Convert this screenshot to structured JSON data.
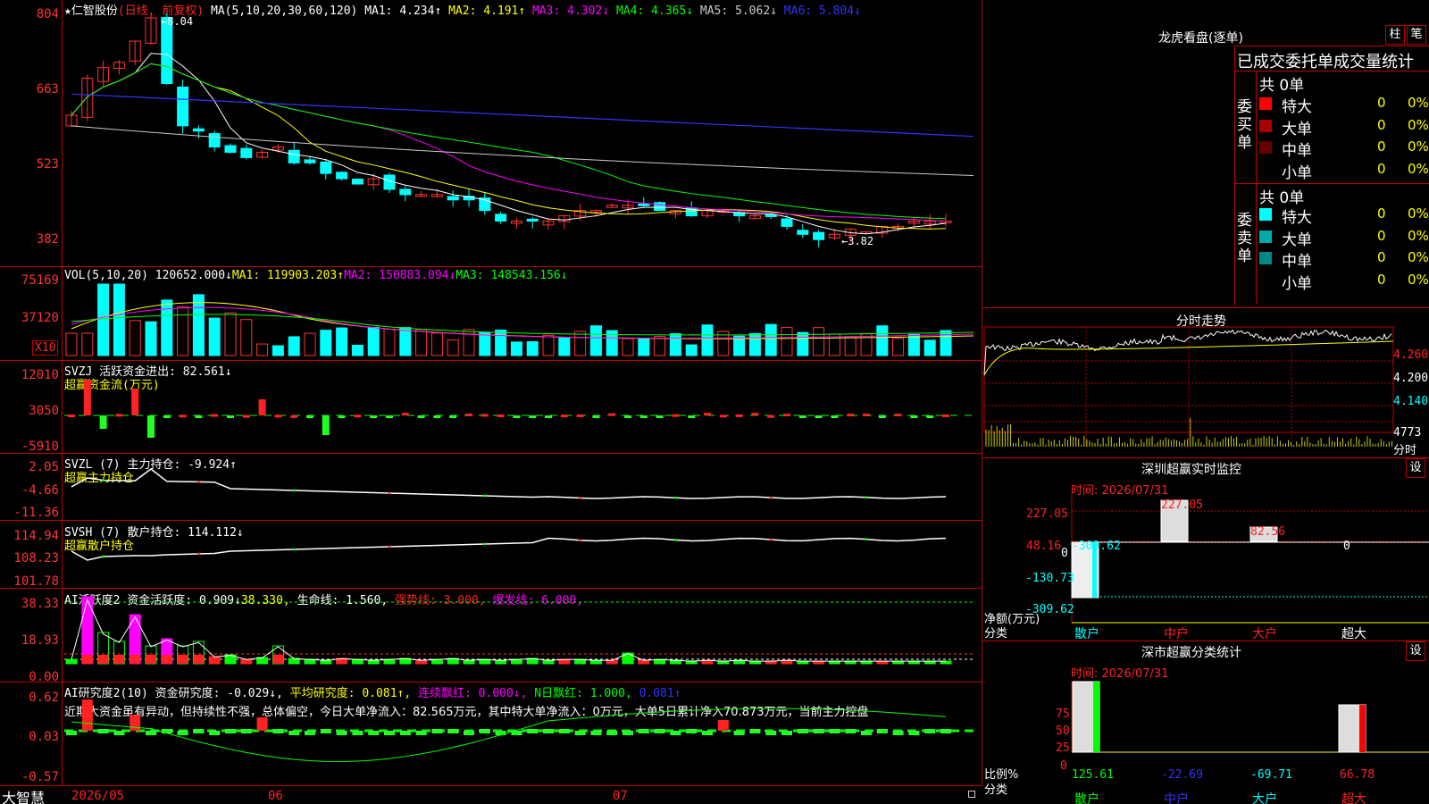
{
  "stock": {
    "name": "仁智股份",
    "mode": "(日线, 前复权)",
    "star": "★"
  },
  "ma_header": {
    "label": "MA(5,10,20,30,60,120)",
    "items": [
      {
        "name": "MA1",
        "text": "MA1: 4.234↑",
        "color": "#ffffff"
      },
      {
        "name": "MA2",
        "text": "MA2: 4.191↑",
        "color": "#ffff00"
      },
      {
        "name": "MA3",
        "text": "MA3: 4.302↓",
        "color": "#ff00ff"
      },
      {
        "name": "MA4",
        "text": "MA4: 4.365↓",
        "color": "#00ff00"
      },
      {
        "name": "MA5",
        "text": "MA5: 5.062↓",
        "color": "#cccccc"
      },
      {
        "name": "MA6",
        "text": "MA6: 5.804↓",
        "color": "#3333ff"
      }
    ]
  },
  "price_axis": [
    "804",
    "663",
    "523",
    "382"
  ],
  "price_high_label": "8.04",
  "price_low_label": "3.82",
  "vol": {
    "label": "VOL(5,10,20)",
    "value": "120652.000↓",
    "ma1": "MA1: 119903.203↑",
    "ma2": "MA2: 150883.094↓",
    "ma3": "MA3: 148543.156↓",
    "axis": [
      "75169",
      "37120"
    ],
    "unit": "X10"
  },
  "svzj": {
    "label": "SVZJ 活跃资金进出:",
    "value": "82.561↓",
    "sub": "超赢资金流(万元)",
    "axis": [
      "12010",
      "3050",
      "-5910"
    ]
  },
  "svzl": {
    "label": "SVZL (7) 主力持仓:",
    "value": "-9.924↑",
    "sub": "超赢主力持仓",
    "axis": [
      "2.05",
      "-4.66",
      "-11.36"
    ]
  },
  "svsh": {
    "label": "SVSH (7) 散户持仓:",
    "value": "114.112↓",
    "sub": "超赢散户持仓",
    "axis": [
      "114.94",
      "108.23",
      "101.78"
    ]
  },
  "ai1": {
    "label": "AI活跃度2 资金活跃度:",
    "v1": "0.909↓",
    "v2": "38.330,",
    "v3": "生命线: 1.560,",
    "v4": "强势线: 3.000,",
    "v5": "爆发线: 6.000,",
    "axis": [
      "38.33",
      "18.93",
      "0.00"
    ]
  },
  "ai2": {
    "label": "AI研究度2(10) 资金研究度:",
    "v1": "-0.029↓,",
    "v2": "平均研究度: 0.081↑,",
    "v3": "连续飘红: 0.000↓,",
    "v4": "N日飘红: 1.000,",
    "v5": "0.081↑",
    "axis": [
      "0.62",
      "0.03",
      "-0.57"
    ],
    "comment": "近期大资金虽有异动，但持续性不强，总体偏空，今日大单净流入：82.565万元，其中特大单净流入：0万元，大单5日累计净入70.873万元，当前主力控盘"
  },
  "bottom_axis": {
    "brand": "大智慧",
    "d1": "2026/05",
    "d2": "06",
    "d3": "07"
  },
  "right": {
    "title": "龙虎看盘(逐单)",
    "btn1": "柱",
    "btn2": "笔",
    "subtitle": "已成交委托单成交量统计",
    "buy_group": "委买单",
    "sell_group": "委卖单",
    "buy_total": "共 0单",
    "sell_total": "共 0单",
    "buy_rows": [
      {
        "label": "特大",
        "count": "0",
        "pct": "0%",
        "color": "#ff0000"
      },
      {
        "label": "大单",
        "count": "0",
        "pct": "0%",
        "color": "#aa0000"
      },
      {
        "label": "中单",
        "count": "0",
        "pct": "0%",
        "color": "#660000"
      },
      {
        "label": "小单",
        "count": "0",
        "pct": "0%",
        "color": ""
      }
    ],
    "sell_rows": [
      {
        "label": "特大",
        "count": "0",
        "pct": "0%",
        "color": "#00ffff"
      },
      {
        "label": "大单",
        "count": "0",
        "pct": "0%",
        "color": "#00aaaa"
      },
      {
        "label": "中单",
        "count": "0",
        "pct": "0%",
        "color": "#008888"
      },
      {
        "label": "小单",
        "count": "0",
        "pct": "0%",
        "color": ""
      }
    ],
    "intraday": {
      "title": "分时走势",
      "axis": [
        "4.260",
        "4.200",
        "4.140"
      ],
      "vol": "4773",
      "unit": "分时"
    },
    "monitor": {
      "title": "深圳超赢实时监控",
      "set": "设",
      "time": "时间: 2026/07/31",
      "axis": [
        "227.05",
        "48.16",
        "0",
        "-130.73",
        "-309.62"
      ],
      "values": [
        "-309.62",
        "227.05",
        "82.56",
        "0"
      ],
      "ylabel1": "净额(万元)",
      "ylabel2": "分类",
      "cats": [
        "散户",
        "中户",
        "大户",
        "超大"
      ]
    },
    "classify": {
      "title": "深市超赢分类统计",
      "set": "设",
      "time": "时间: 2026/07/31",
      "axis": [
        "75",
        "50",
        "25",
        "0"
      ],
      "values": [
        "125.61",
        "-22.69",
        "-69.71",
        "66.78"
      ],
      "ylabel1": "比例%",
      "ylabel2": "分类",
      "cats": [
        "散户",
        "中户",
        "大户",
        "超大"
      ]
    }
  }
}
